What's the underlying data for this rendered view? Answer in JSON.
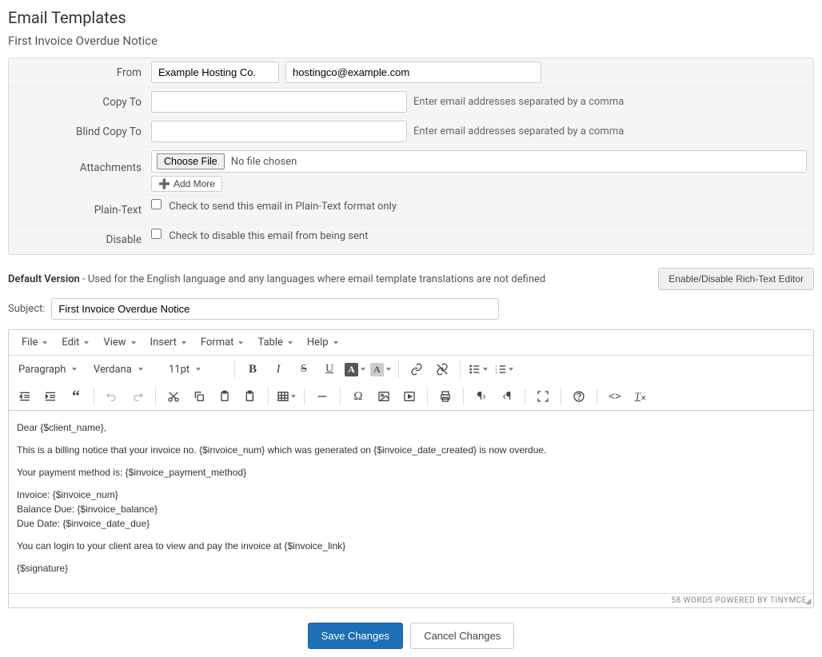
{
  "page": {
    "title": "Email Templates",
    "subtitle": "First Invoice Overdue Notice"
  },
  "form": {
    "from_label": "From",
    "from_name": "Example Hosting Co.",
    "from_email": "hostingco@example.com",
    "copy_label": "Copy To",
    "copy_value": "",
    "copy_help": "Enter email addresses separated by a comma",
    "bcc_label": "Blind Copy To",
    "bcc_value": "",
    "bcc_help": "Enter email addresses separated by a comma",
    "attachments_label": "Attachments",
    "choose_file": "Choose File",
    "no_file": "No file chosen",
    "add_more": "Add More",
    "plaintext_label": "Plain-Text",
    "plaintext_text": "Check to send this email in Plain-Text format only",
    "disable_label": "Disable",
    "disable_text": "Check to disable this email from being sent"
  },
  "mid": {
    "default_label": "Default Version",
    "default_desc": " - Used for the English language and any languages where email template translations are not defined",
    "toggle_button": "Enable/Disable Rich-Text Editor"
  },
  "subject": {
    "label": "Subject:",
    "value": "First Invoice Overdue Notice"
  },
  "menubar": {
    "file": "File",
    "edit": "Edit",
    "view": "View",
    "insert": "Insert",
    "format": "Format",
    "table": "Table",
    "help": "Help"
  },
  "toolbar": {
    "block": "Paragraph",
    "font": "Verdana",
    "size": "11pt"
  },
  "body": {
    "l1": "Dear {$client_name},",
    "l2": "This is a billing notice that your invoice no. {$invoice_num} which was generated on {$invoice_date_created} is now overdue.",
    "l3": "Your payment method is: {$invoice_payment_method}",
    "l4a": "Invoice: {$invoice_num}",
    "l4b": "Balance Due: {$invoice_balance}",
    "l4c": "Due Date: {$invoice_date_due}",
    "l5": "You can login to your client area to view and pay the invoice at {$invoice_link}",
    "l6": "{$signature}"
  },
  "status": {
    "text": "58 WORDS POWERED BY TINYMCE"
  },
  "actions": {
    "save": "Save Changes",
    "cancel": "Cancel Changes"
  }
}
